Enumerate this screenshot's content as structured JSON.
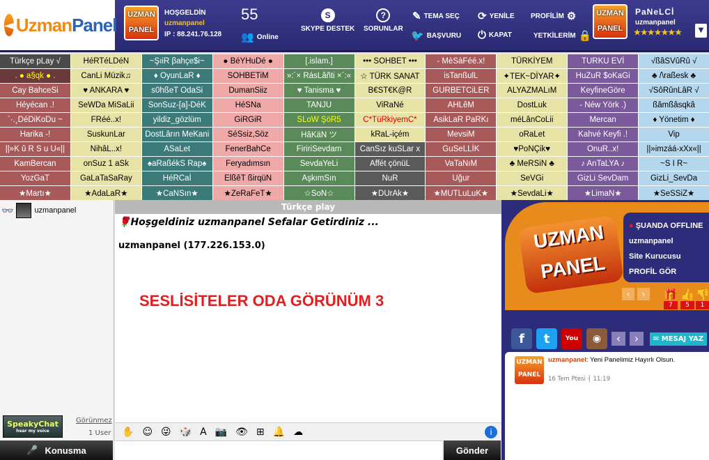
{
  "header": {
    "logo_main": "Uzman",
    "logo_accent": "Panel",
    "badge_top": "UZMAN",
    "badge_bottom": "PANEL",
    "welcome": "HOŞGELDİN",
    "username": "uzmanpanel",
    "ip": "IP : 88.241.76.128",
    "online_count": "55",
    "online_label": "Online",
    "skype": "SKYPE DESTEK",
    "sorunlar": "SORUNLAR",
    "tema": "TEMA SEÇ",
    "basvuru": "BAŞVURU",
    "yenile": "YENİLE",
    "kapat": "KAPAT",
    "profilim": "PROFİLİM",
    "yetkilerim": "YETKİLERİM",
    "panel_title": "PaNeLCİ",
    "panel_user": "uzmanpanel",
    "stars": "★★★★★★★"
  },
  "rooms": [
    {
      "t": "Türkçe pLay √",
      "bg": "#4a4a4a",
      "c": "#fff"
    },
    {
      "t": "HéRTéLDéN",
      "bg": "#e7e2a5",
      "c": "#000"
    },
    {
      "t": "~ŞıiR βahçe$i~",
      "bg": "#3c7a7a",
      "c": "#fff"
    },
    {
      "t": "● BéYHuDé ●",
      "bg": "#f0a9a9",
      "c": "#000"
    },
    {
      "t": "[.islam.]",
      "bg": "#5a8a5a",
      "c": "#fff"
    },
    {
      "t": "••• SOHBET •••",
      "bg": "#e7e2a5",
      "c": "#000"
    },
    {
      "t": "- MèSàFéé.x!",
      "bg": "#a85a5a",
      "c": "#fff"
    },
    {
      "t": "TÜRKİYEM",
      "bg": "#e7e2a5",
      "c": "#000"
    },
    {
      "t": "TURKU EVİ",
      "bg": "#7a5a9a",
      "c": "#fff"
    },
    {
      "t": "√ßâSVûRû √",
      "bg": "#b5d7ee",
      "c": "#000"
    },
    {
      "t": ". ● a§qk ● .",
      "bg": "#6a3a3a",
      "c": "#ff0"
    },
    {
      "t": "CanLi Müzik♫",
      "bg": "#e7e2a5",
      "c": "#000"
    },
    {
      "t": "♦ OyunLaR ♦",
      "bg": "#3c7a7a",
      "c": "#fff"
    },
    {
      "t": "SOHBETiM",
      "bg": "#f0a9a9",
      "c": "#000"
    },
    {
      "t": "»:´× RásLâñti ×´:«",
      "bg": "#5a8a5a",
      "c": "#fff"
    },
    {
      "t": "☆ TÜRK SANAT",
      "bg": "#e7e2a5",
      "c": "#000"
    },
    {
      "t": "isTanßulL",
      "bg": "#a85a5a",
      "c": "#fff"
    },
    {
      "t": "✦TEK~DİYAR✦",
      "bg": "#e7e2a5",
      "c": "#000"
    },
    {
      "t": "HuZuR $oKaGi",
      "bg": "#7a5a9a",
      "c": "#fff"
    },
    {
      "t": "♣ /\\raßesk ♣",
      "bg": "#b5d7ee",
      "c": "#000"
    },
    {
      "t": "Cay BahceSi",
      "bg": "#a85a5a",
      "c": "#fff"
    },
    {
      "t": "♥ ANKARA ♥",
      "bg": "#e7e2a5",
      "c": "#000"
    },
    {
      "t": "s0hßeT OdaSi",
      "bg": "#3c7a7a",
      "c": "#fff"
    },
    {
      "t": "DumanSiiz",
      "bg": "#f0a9a9",
      "c": "#000"
    },
    {
      "t": "♥ Tanisma ♥",
      "bg": "#5a8a5a",
      "c": "#fff"
    },
    {
      "t": "B€ST€K@R",
      "bg": "#e7e2a5",
      "c": "#000"
    },
    {
      "t": "GURBETCiLER",
      "bg": "#a85a5a",
      "c": "#fff"
    },
    {
      "t": "ALYAZMALıM",
      "bg": "#e7e2a5",
      "c": "#000"
    },
    {
      "t": "KeyfineGöre",
      "bg": "#7a5a9a",
      "c": "#fff"
    },
    {
      "t": "√SôRûnLâR √",
      "bg": "#b5d7ee",
      "c": "#000"
    },
    {
      "t": "Héyécan .!",
      "bg": "#a85a5a",
      "c": "#fff"
    },
    {
      "t": "SeWDa MiSaLii",
      "bg": "#e7e2a5",
      "c": "#000"
    },
    {
      "t": "SonSuz-[a]-DéK",
      "bg": "#3c7a7a",
      "c": "#fff"
    },
    {
      "t": "HéSNa",
      "bg": "#f0a9a9",
      "c": "#000"
    },
    {
      "t": "TANJU",
      "bg": "#5a8a5a",
      "c": "#fff"
    },
    {
      "t": "ViRaNé",
      "bg": "#e7e2a5",
      "c": "#000"
    },
    {
      "t": "AHLêM",
      "bg": "#a85a5a",
      "c": "#fff"
    },
    {
      "t": "DostLuk",
      "bg": "#e7e2a5",
      "c": "#000"
    },
    {
      "t": "- Néw Yörk .)",
      "bg": "#7a5a9a",
      "c": "#fff"
    },
    {
      "t": "ßâmßâsqkâ",
      "bg": "#b5d7ee",
      "c": "#000"
    },
    {
      "t": "`·.¸DéDiKoDu ~",
      "bg": "#a85a5a",
      "c": "#fff"
    },
    {
      "t": "FRéé..x!",
      "bg": "#e7e2a5",
      "c": "#000"
    },
    {
      "t": "yildiz_gözlüm",
      "bg": "#3c7a7a",
      "c": "#fff"
    },
    {
      "t": "GiRGiR",
      "bg": "#f0a9a9",
      "c": "#000"
    },
    {
      "t": "SLoW ŞöR5",
      "bg": "#5a8a5a",
      "c": "#ff0"
    },
    {
      "t": "C*TüRkiyemC*",
      "bg": "#e7e2a5",
      "c": "#d00"
    },
    {
      "t": "AsikLaR PaRKı",
      "bg": "#a85a5a",
      "c": "#fff"
    },
    {
      "t": "méLânCoLii",
      "bg": "#e7e2a5",
      "c": "#000"
    },
    {
      "t": "Mercan",
      "bg": "#7a5a9a",
      "c": "#fff"
    },
    {
      "t": "♦ Yönetim ♦",
      "bg": "#b5d7ee",
      "c": "#000"
    },
    {
      "t": "Harika -!",
      "bg": "#a85a5a",
      "c": "#fff"
    },
    {
      "t": "SuskunLar",
      "bg": "#e7e2a5",
      "c": "#000"
    },
    {
      "t": "DostLârın MeKani",
      "bg": "#3c7a7a",
      "c": "#fff"
    },
    {
      "t": "SéSsiz,Söz",
      "bg": "#f0a9a9",
      "c": "#000"
    },
    {
      "t": "HâKäN ツ",
      "bg": "#5a8a5a",
      "c": "#fff"
    },
    {
      "t": "kRaL-içém",
      "bg": "#e7e2a5",
      "c": "#000"
    },
    {
      "t": "MevsiM",
      "bg": "#a85a5a",
      "c": "#fff"
    },
    {
      "t": "oRaLet",
      "bg": "#e7e2a5",
      "c": "#000"
    },
    {
      "t": "Kahvé Keyfi .!",
      "bg": "#7a5a9a",
      "c": "#fff"
    },
    {
      "t": "Vip",
      "bg": "#b5d7ee",
      "c": "#000"
    },
    {
      "t": "||»K û R S u U«||",
      "bg": "#a85a5a",
      "c": "#fff"
    },
    {
      "t": "NihâL..x!",
      "bg": "#e7e2a5",
      "c": "#000"
    },
    {
      "t": "ASaLet",
      "bg": "#3c7a7a",
      "c": "#fff"
    },
    {
      "t": "FenerBahCe",
      "bg": "#f0a9a9",
      "c": "#000"
    },
    {
      "t": "FiririSevdam",
      "bg": "#5a8a5a",
      "c": "#fff"
    },
    {
      "t": "CanSız kuSLar x",
      "bg": "#5a5a5a",
      "c": "#fff"
    },
    {
      "t": "GuSeLLİK",
      "bg": "#a85a5a",
      "c": "#fff"
    },
    {
      "t": "♥PoNÇik♥",
      "bg": "#e7e2a5",
      "c": "#000"
    },
    {
      "t": "OnuR..x!",
      "bg": "#7a5a9a",
      "c": "#fff"
    },
    {
      "t": "||»imzáá-xXx«||",
      "bg": "#b5d7ee",
      "c": "#000"
    },
    {
      "t": "KamBercan",
      "bg": "#a85a5a",
      "c": "#fff"
    },
    {
      "t": "onSuz 1 aSk",
      "bg": "#e7e2a5",
      "c": "#000"
    },
    {
      "t": "♠aRaßékS Rap♠",
      "bg": "#3c7a7a",
      "c": "#fff"
    },
    {
      "t": "Feryadımsın",
      "bg": "#f0a9a9",
      "c": "#000"
    },
    {
      "t": "SevdaYeLi",
      "bg": "#5a8a5a",
      "c": "#fff"
    },
    {
      "t": "Affét çönüL",
      "bg": "#5a5a5a",
      "c": "#fff"
    },
    {
      "t": "VaTaNıM",
      "bg": "#a85a5a",
      "c": "#fff"
    },
    {
      "t": "♣ MeRSiN ♣",
      "bg": "#e7e2a5",
      "c": "#000"
    },
    {
      "t": "♪ AnTaLYA ♪",
      "bg": "#7a5a9a",
      "c": "#fff"
    },
    {
      "t": "~S I R~",
      "bg": "#b5d7ee",
      "c": "#000"
    },
    {
      "t": "YozGaT",
      "bg": "#a85a5a",
      "c": "#fff"
    },
    {
      "t": "GaLaTaSaRay",
      "bg": "#e7e2a5",
      "c": "#000"
    },
    {
      "t": "HéRCaİ",
      "bg": "#3c7a7a",
      "c": "#fff"
    },
    {
      "t": "ElßêT ßirqüN",
      "bg": "#f0a9a9",
      "c": "#000"
    },
    {
      "t": "AşkımSın",
      "bg": "#5a8a5a",
      "c": "#fff"
    },
    {
      "t": "NuR",
      "bg": "#5a5a5a",
      "c": "#fff"
    },
    {
      "t": "Uğur",
      "bg": "#a85a5a",
      "c": "#fff"
    },
    {
      "t": "SeVGi",
      "bg": "#e7e2a5",
      "c": "#000"
    },
    {
      "t": "GizLi SevDam",
      "bg": "#7a5a9a",
      "c": "#fff"
    },
    {
      "t": "GizLi_SevDa",
      "bg": "#b5d7ee",
      "c": "#000"
    },
    {
      "t": "★Martı★",
      "bg": "#a85a5a",
      "c": "#fff"
    },
    {
      "t": "★AdaLaR★",
      "bg": "#e7e2a5",
      "c": "#000"
    },
    {
      "t": "★CaNSın★",
      "bg": "#3c7a7a",
      "c": "#fff"
    },
    {
      "t": "★ZeRaFeT★",
      "bg": "#f0a9a9",
      "c": "#000"
    },
    {
      "t": "☆SoN☆",
      "bg": "#5a8a5a",
      "c": "#fff"
    },
    {
      "t": "★DUrAk★",
      "bg": "#5a5a5a",
      "c": "#fff"
    },
    {
      "t": "★MUTLuLuK★",
      "bg": "#a85a5a",
      "c": "#fff"
    },
    {
      "t": "★SevdaLi★",
      "bg": "#e7e2a5",
      "c": "#000"
    },
    {
      "t": "★LimaN★",
      "bg": "#7a5a9a",
      "c": "#fff"
    },
    {
      "t": "★SeSSiZ★",
      "bg": "#b5d7ee",
      "c": "#000"
    }
  ],
  "left": {
    "user": "uzmanpanel",
    "speaky_top": "SpeakyChat",
    "speaky_sub": "hear my voice",
    "gorunmez": "Görünmez",
    "user_count": "1 User",
    "talk": "Konusma"
  },
  "chat": {
    "room": "Türkçe play",
    "welcome": "Hoşgeldiniz uzmanpanel Sefalar Getirdiniz ...",
    "line2": "uzmanpanel (177.226.153.0)",
    "big": "SESLİSİTELER ODA GÖRÜNÜM 3",
    "send": "Gönder"
  },
  "right": {
    "status": "ŞUANDA OFFLINE",
    "user": "uzmanpanel",
    "owner": "Site Kurucusu",
    "profile": "PROFİL GÖR",
    "badge_top": "UZMAN",
    "badge_bottom": "PANEL",
    "gift": "7",
    "like": "5",
    "dislike": "1",
    "message": "MESAJ YAZ",
    "post_user": "uzmanpanel",
    "post_text": ": Yeni Panelimiz Hayırlı Olsun.",
    "post_time": "16 Tem Ptesi ┤ 11:19",
    "post_badge_top": "UZMAN",
    "post_badge_bottom": "PANEL"
  }
}
